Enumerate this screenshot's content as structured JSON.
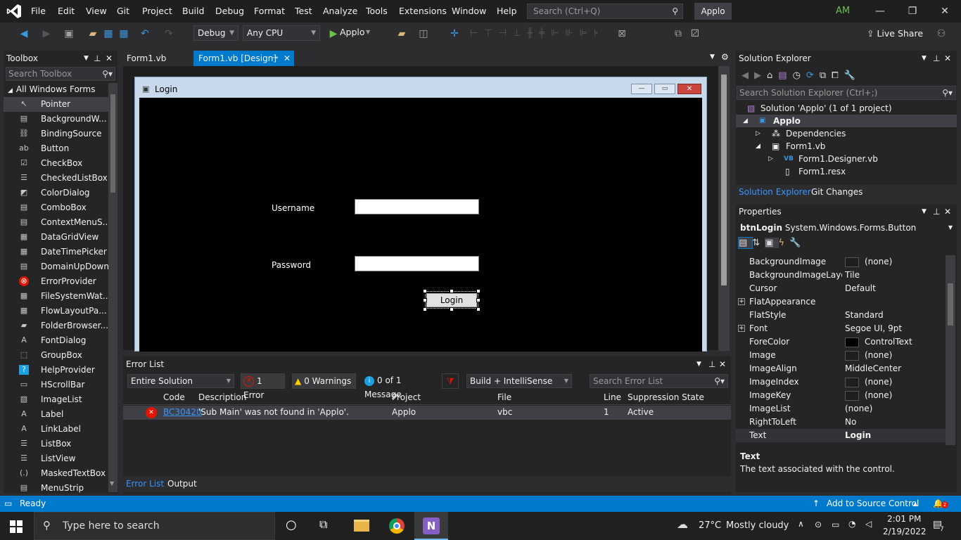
{
  "menu": [
    "File",
    "Edit",
    "View",
    "Git",
    "Project",
    "Build",
    "Debug",
    "Format",
    "Test",
    "Analyze",
    "Tools",
    "Extensions",
    "Window",
    "Help"
  ],
  "search": {
    "placeholder": "Search (Ctrl+Q)"
  },
  "app_name": "Applo",
  "user_initials": "AM",
  "toolbar": {
    "config": "Debug",
    "platform": "Any CPU",
    "run_label": "Applo",
    "live_share": "Live Share"
  },
  "toolbox": {
    "title": "Toolbox",
    "search_placeholder": "Search Toolbox",
    "group": "All Windows Forms",
    "items": [
      "Pointer",
      "BackgroundW...",
      "BindingSource",
      "Button",
      "CheckBox",
      "CheckedListBox",
      "ColorDialog",
      "ComboBox",
      "ContextMenuS...",
      "DataGridView",
      "DateTimePicker",
      "DomainUpDown",
      "ErrorProvider",
      "FileSystemWat...",
      "FlowLayoutPa...",
      "FolderBrowser...",
      "FontDialog",
      "GroupBox",
      "HelpProvider",
      "HScrollBar",
      "ImageList",
      "Label",
      "LinkLabel",
      "ListBox",
      "ListView",
      "MaskedTextBox",
      "MenuStrip"
    ]
  },
  "tabs": [
    "Form1.vb",
    "Form1.vb [Design]"
  ],
  "form": {
    "title": "Login",
    "username_label": "Username",
    "password_label": "Password",
    "button_label": "Login"
  },
  "error_list": {
    "title": "Error List",
    "scope": "Entire Solution",
    "errors": "1 Error",
    "warnings": "0 Warnings",
    "messages": "0 of 1 Message",
    "build_filter": "Build + IntelliSense",
    "search_placeholder": "Search Error List",
    "columns": [
      "Code",
      "Description",
      "Project",
      "File",
      "Line",
      "Suppression State"
    ],
    "rows": [
      {
        "code": "BC30420",
        "description": "'Sub Main' was not found in 'Applo'.",
        "project": "Applo",
        "file": "vbc",
        "line": "1",
        "state": "Active"
      }
    ],
    "bottom_tabs": [
      "Error List",
      "Output"
    ]
  },
  "solution_explorer": {
    "title": "Solution Explorer",
    "search_placeholder": "Search Solution Explorer (Ctrl+;)",
    "tree": [
      "Solution 'Applo' (1 of 1 project)",
      "Applo",
      "Dependencies",
      "Form1.vb",
      "Form1.Designer.vb",
      "Form1.resx"
    ],
    "tabs": [
      "Solution Explorer",
      "Git Changes"
    ]
  },
  "properties": {
    "title": "Properties",
    "object": "btnLogin",
    "object_type": "System.Windows.Forms.Button",
    "rows": [
      {
        "name": "BackgroundImage",
        "value": "(none)",
        "swatch": "#1e1e1e"
      },
      {
        "name": "BackgroundImageLayout",
        "value": "Tile"
      },
      {
        "name": "Cursor",
        "value": "Default"
      },
      {
        "name": "FlatAppearance",
        "value": "",
        "expand": true
      },
      {
        "name": "FlatStyle",
        "value": "Standard"
      },
      {
        "name": "Font",
        "value": "Segoe UI, 9pt",
        "expand": true
      },
      {
        "name": "ForeColor",
        "value": "ControlText",
        "swatch": "#000000"
      },
      {
        "name": "Image",
        "value": "(none)",
        "swatch": "#1e1e1e"
      },
      {
        "name": "ImageAlign",
        "value": "MiddleCenter"
      },
      {
        "name": "ImageIndex",
        "value": "(none)",
        "swatch": "#1e1e1e"
      },
      {
        "name": "ImageKey",
        "value": "(none)",
        "swatch": "#1e1e1e"
      },
      {
        "name": "ImageList",
        "value": "(none)"
      },
      {
        "name": "RightToLeft",
        "value": "No"
      },
      {
        "name": "Text",
        "value": "Login",
        "bold": true
      }
    ],
    "desc_title": "Text",
    "desc_text": "The text associated with the control."
  },
  "status": {
    "ready": "Ready",
    "source_control": "Add to Source Control",
    "notif_count": "2"
  },
  "taskbar": {
    "search": "Type here to search",
    "weather_temp": "27°C",
    "weather_desc": "Mostly cloudy",
    "time": "2:01 PM",
    "date": "2/19/2022",
    "notif": "7"
  },
  "colors": {
    "accent": "#007acc",
    "error": "#e51400",
    "vs_purple": "#865fc5"
  }
}
